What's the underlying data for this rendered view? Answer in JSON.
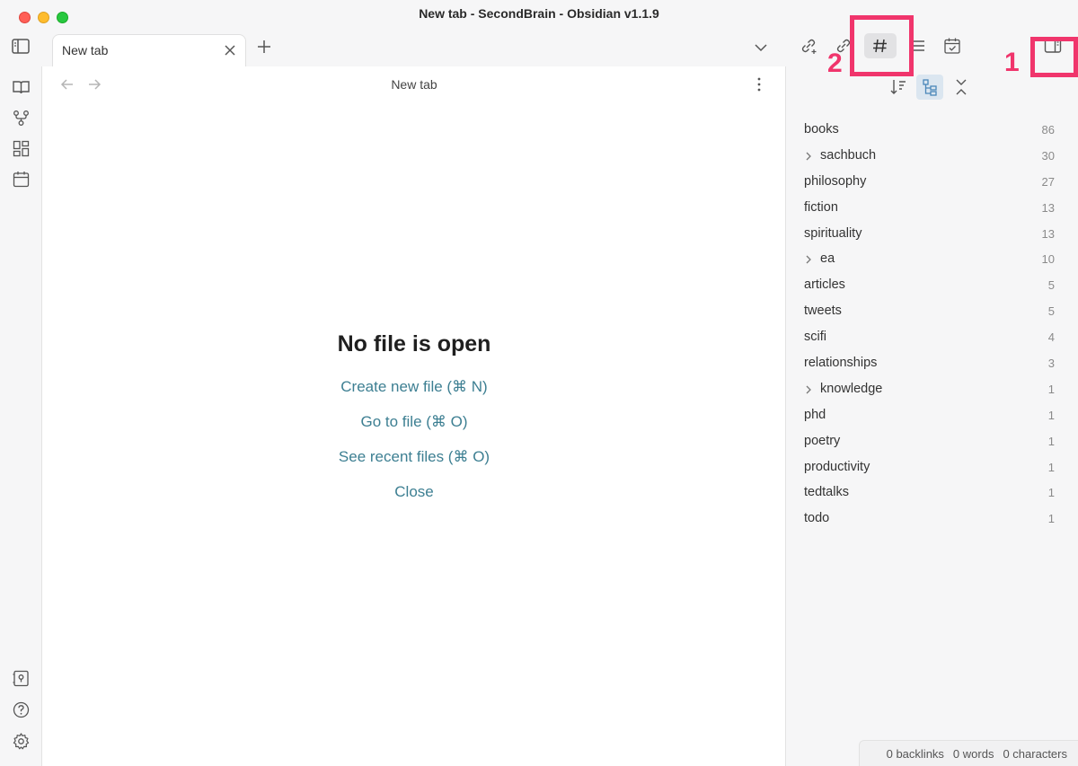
{
  "window": {
    "title": "New tab - SecondBrain - Obsidian v1.1.9"
  },
  "tabs": [
    {
      "label": "New tab"
    }
  ],
  "main": {
    "view_title": "New tab",
    "empty_title": "No file is open",
    "actions": [
      "Create new file (⌘ N)",
      "Go to file (⌘ O)",
      "See recent files (⌘ O)",
      "Close"
    ]
  },
  "ribbon": {
    "icons": [
      "open-quick-switcher",
      "graph-view",
      "canvas",
      "daily-note",
      "vault-switcher",
      "help",
      "settings"
    ]
  },
  "sidebar": {
    "header_icons": [
      "backlinks",
      "outgoing-links",
      "tags",
      "outline",
      "tasks",
      "toggle-right-sidebar"
    ],
    "active_header": "tags",
    "tag_toolbar": [
      "sort",
      "tree-view",
      "collapse-all"
    ],
    "tags": [
      {
        "name": "books",
        "count": "86",
        "expandable": false
      },
      {
        "name": "sachbuch",
        "count": "30",
        "expandable": true
      },
      {
        "name": "philosophy",
        "count": "27",
        "expandable": false
      },
      {
        "name": "fiction",
        "count": "13",
        "expandable": false
      },
      {
        "name": "spirituality",
        "count": "13",
        "expandable": false
      },
      {
        "name": "ea",
        "count": "10",
        "expandable": true
      },
      {
        "name": "articles",
        "count": "5",
        "expandable": false
      },
      {
        "name": "tweets",
        "count": "5",
        "expandable": false
      },
      {
        "name": "scifi",
        "count": "4",
        "expandable": false
      },
      {
        "name": "relationships",
        "count": "3",
        "expandable": false
      },
      {
        "name": "knowledge",
        "count": "1",
        "expandable": true
      },
      {
        "name": "phd",
        "count": "1",
        "expandable": false
      },
      {
        "name": "poetry",
        "count": "1",
        "expandable": false
      },
      {
        "name": "productivity",
        "count": "1",
        "expandable": false
      },
      {
        "name": "tedtalks",
        "count": "1",
        "expandable": false
      },
      {
        "name": "todo",
        "count": "1",
        "expandable": false
      }
    ]
  },
  "annotations": {
    "label_1": "1",
    "label_2": "2",
    "highlight_color": "#f0356c"
  },
  "status_bar": {
    "backlinks": "0 backlinks",
    "words": "0 words",
    "characters": "0 characters"
  },
  "colors": {
    "link": "#3d7f92",
    "accent_active": "#dbe6f0"
  }
}
